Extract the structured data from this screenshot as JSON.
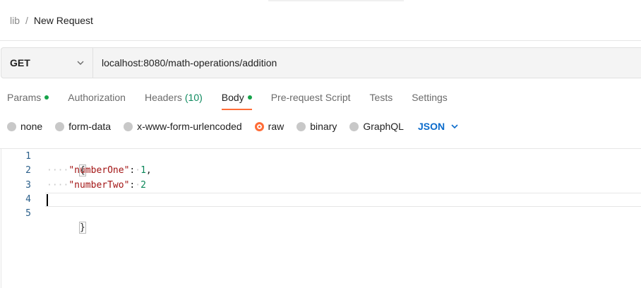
{
  "breadcrumb": {
    "parent": "lib",
    "separator": "/",
    "current": "New Request"
  },
  "request": {
    "method": "GET",
    "url": "localhost:8080/math-operations/addition"
  },
  "tabs": [
    {
      "label": "Params",
      "indicator": true
    },
    {
      "label": "Authorization"
    },
    {
      "label": "Headers",
      "count": "(10)"
    },
    {
      "label": "Body",
      "indicator": true,
      "active": true
    },
    {
      "label": "Pre-request Script"
    },
    {
      "label": "Tests"
    },
    {
      "label": "Settings"
    }
  ],
  "body_types": {
    "options": [
      "none",
      "form-data",
      "x-www-form-urlencoded",
      "raw",
      "binary",
      "GraphQL"
    ],
    "selected": "raw",
    "language": "JSON"
  },
  "editor": {
    "line_numbers": [
      "1",
      "2",
      "3",
      "4",
      "5"
    ],
    "open_brace": "{",
    "close_brace": "}",
    "ws_indent": "····",
    "entries": [
      {
        "key": "\"numberOne\"",
        "sep": ":",
        "value": "1",
        "trail": ","
      },
      {
        "key": "\"numberTwo\"",
        "sep": ":",
        "value": "2",
        "trail": ""
      }
    ],
    "cursor_line": 4
  },
  "colors": {
    "accent": "#ff6c37",
    "indicator": "#16a34a",
    "link": "#0b6bcb",
    "json_key": "#a31515",
    "json_number": "#098658"
  }
}
